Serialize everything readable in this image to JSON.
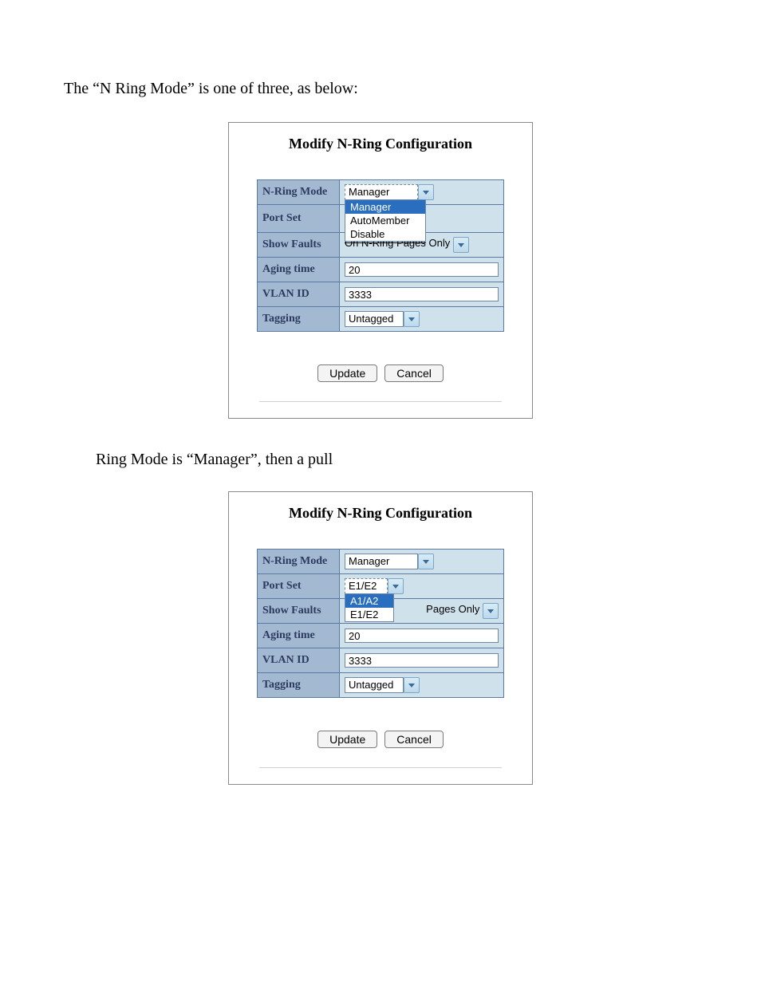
{
  "texts": {
    "intro": "The “N Ring Mode” is one of three, as below:",
    "mid": "Ring Mode is “Manager”, then a pull"
  },
  "panel1": {
    "title": "Modify N-Ring Configuration",
    "rows": {
      "nring_mode": {
        "label": "N-Ring Mode",
        "value": "Manager"
      },
      "port_set": {
        "label": "Port Set"
      },
      "show_faults": {
        "label": "Show Faults",
        "struck": "On N-Ring Pages",
        "suffix": "Only"
      },
      "agingtime": {
        "label": "Aging time",
        "value": "20"
      },
      "vlan_id": {
        "label": "VLAN ID",
        "value": "3333"
      },
      "tagging": {
        "label": "Tagging",
        "value": "Untagged"
      }
    },
    "mode_options": [
      {
        "label": "Manager",
        "selected": true
      },
      {
        "label": "AutoMember",
        "selected": false
      },
      {
        "label": "Disable",
        "selected": false
      }
    ],
    "buttons": {
      "update": "Update",
      "cancel": "Cancel"
    }
  },
  "panel2": {
    "title": "Modify N-Ring Configuration",
    "rows": {
      "nring_mode": {
        "label": "N-Ring Mode",
        "value": "Manager"
      },
      "port_set": {
        "label": "Port Set",
        "value": "E1/E2"
      },
      "show_faults": {
        "label": "Show Faults",
        "suffix": "Pages Only"
      },
      "agingtime": {
        "label": "Aging time",
        "value": "20"
      },
      "vlan_id": {
        "label": "VLAN ID",
        "value": "3333"
      },
      "tagging": {
        "label": "Tagging",
        "value": "Untagged"
      }
    },
    "portset_options": [
      {
        "label": "A1/A2",
        "selected": true
      },
      {
        "label": "E1/E2",
        "selected": false
      }
    ],
    "buttons": {
      "update": "Update",
      "cancel": "Cancel"
    }
  }
}
